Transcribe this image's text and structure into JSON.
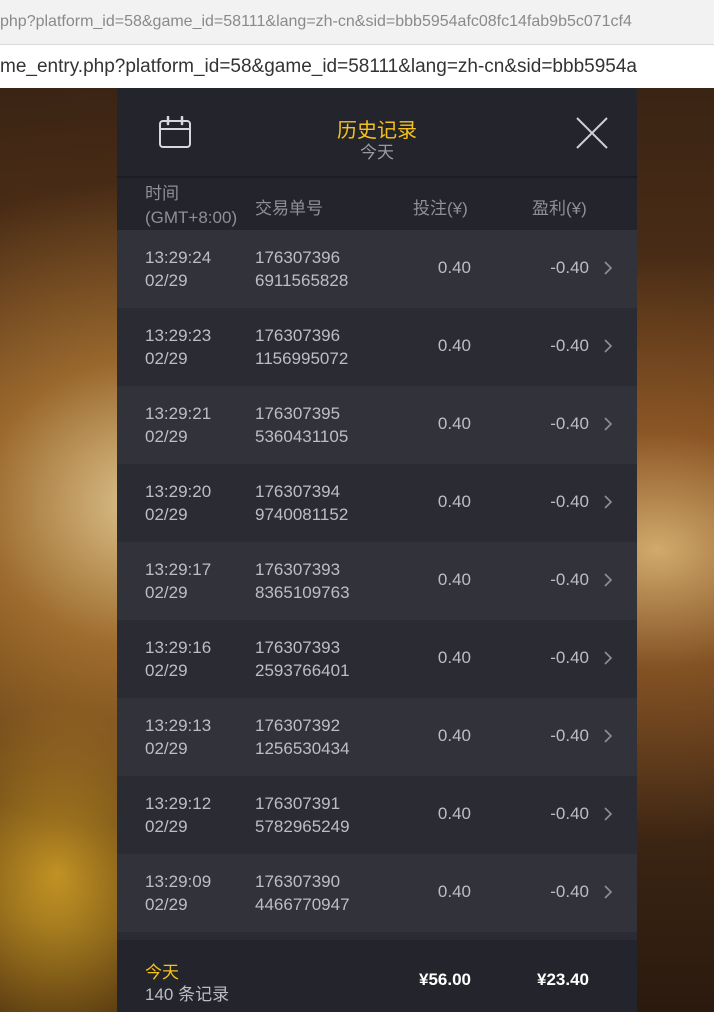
{
  "browser": {
    "url_line_1": "php?platform_id=58&game_id=58111&lang=zh-cn&sid=bbb5954afc08fc14fab9b5c071cf4",
    "url_line_2": "me_entry.php?platform_id=58&game_id=58111&lang=zh-cn&sid=bbb5954a"
  },
  "header": {
    "title": "历史记录",
    "subtitle": "今天",
    "calendar_icon": "calendar-icon",
    "close_icon": "close-icon",
    "title_color": "#f6c21b"
  },
  "columns": {
    "time_line1": "时间",
    "time_line2": "(GMT+8:00)",
    "transaction_id": "交易单号",
    "bet": "投注(¥)",
    "profit": "盈利(¥)"
  },
  "rows": [
    {
      "time": "13:29:24",
      "date": "02/29",
      "id1": "176307396",
      "id2": "6911565828",
      "bet": "0.40",
      "profit": "-0.40"
    },
    {
      "time": "13:29:23",
      "date": "02/29",
      "id1": "176307396",
      "id2": "1156995072",
      "bet": "0.40",
      "profit": "-0.40"
    },
    {
      "time": "13:29:21",
      "date": "02/29",
      "id1": "176307395",
      "id2": "5360431105",
      "bet": "0.40",
      "profit": "-0.40"
    },
    {
      "time": "13:29:20",
      "date": "02/29",
      "id1": "176307394",
      "id2": "9740081152",
      "bet": "0.40",
      "profit": "-0.40"
    },
    {
      "time": "13:29:17",
      "date": "02/29",
      "id1": "176307393",
      "id2": "8365109763",
      "bet": "0.40",
      "profit": "-0.40"
    },
    {
      "time": "13:29:16",
      "date": "02/29",
      "id1": "176307393",
      "id2": "2593766401",
      "bet": "0.40",
      "profit": "-0.40"
    },
    {
      "time": "13:29:13",
      "date": "02/29",
      "id1": "176307392",
      "id2": "1256530434",
      "bet": "0.40",
      "profit": "-0.40"
    },
    {
      "time": "13:29:12",
      "date": "02/29",
      "id1": "176307391",
      "id2": "5782965249",
      "bet": "0.40",
      "profit": "-0.40"
    },
    {
      "time": "13:29:09",
      "date": "02/29",
      "id1": "176307390",
      "id2": "4466770947",
      "bet": "0.40",
      "profit": "-0.40"
    }
  ],
  "footer": {
    "period": "今天",
    "record_count": "140 条记录",
    "total_bet": "¥56.00",
    "total_profit": "¥23.40"
  }
}
